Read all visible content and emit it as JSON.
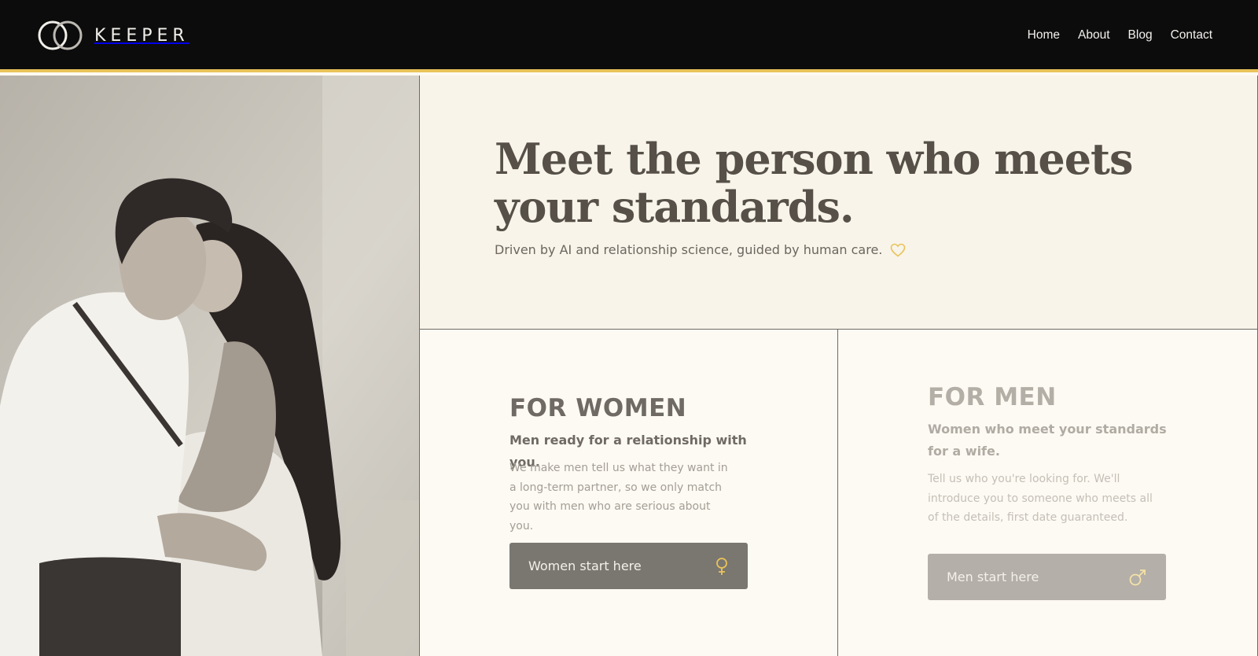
{
  "brand": {
    "name": "KEEPER",
    "accent": "#e9c35a",
    "header_bg": "#0d0c0d"
  },
  "nav": {
    "items": [
      "Home",
      "About",
      "Blog",
      "Contact"
    ]
  },
  "hero": {
    "headline": "Meet the person who meets your standards.",
    "subtitle": "Driven by AI and relationship science, guided by human care.",
    "subtitle_icon": "heart-outline-icon"
  },
  "photo": {
    "description_icon": "couple-photo"
  },
  "women": {
    "title": "FOR WOMEN",
    "tagline": "Men ready for a relationship with you.",
    "description": "We make men tell us what they want in a long-term partner, so we only match you with men who are serious about you.",
    "button_label": "Women start here",
    "button_icon": "female-symbol-icon"
  },
  "men": {
    "title": "FOR MEN",
    "tagline": "Women who meet your standards for a wife.",
    "description": "Tell us who you're looking for. We'll introduce you to someone who meets all of the details, first date guaranteed.",
    "button_label": "Men start here",
    "button_icon": "male-symbol-icon"
  }
}
